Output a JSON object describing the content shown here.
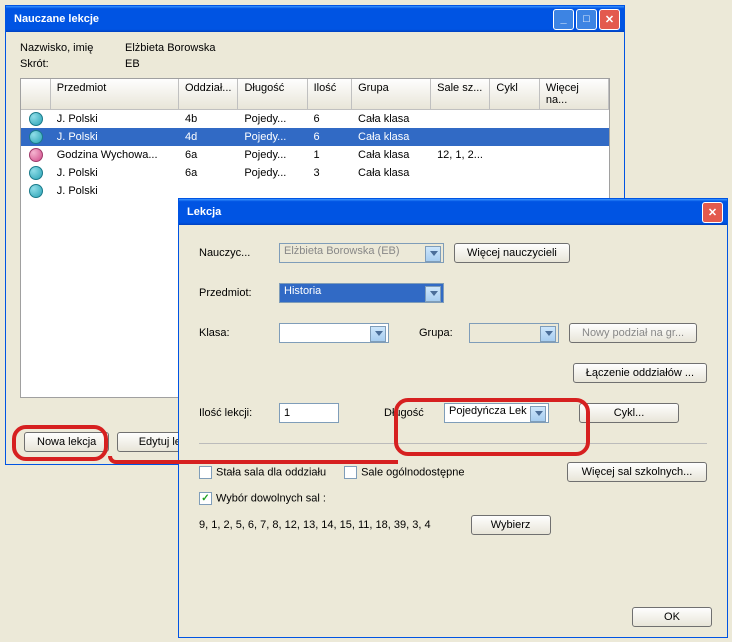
{
  "win1": {
    "title": "Nauczane lekcje",
    "nameLabel": "Nazwisko, imię",
    "nameValue": "Elżbieta Borowska",
    "abbrLabel": "Skrót:",
    "abbrValue": "EB",
    "headers": [
      "Przedmiot",
      "Oddział...",
      "Długość",
      "Ilość",
      "Grupa",
      "Sale sz...",
      "Cykl",
      "Więcej na..."
    ],
    "rows": [
      {
        "icon": "teal",
        "c": [
          "J. Polski",
          "4b",
          "Pojedy...",
          "6",
          "Cała klasa",
          "",
          "",
          ""
        ]
      },
      {
        "icon": "teal",
        "sel": true,
        "c": [
          "J. Polski",
          "4d",
          "Pojedy...",
          "6",
          "Cała klasa",
          "",
          "",
          ""
        ]
      },
      {
        "icon": "pink",
        "c": [
          "Godzina Wychowa...",
          "6a",
          "Pojedy...",
          "1",
          "Cała klasa",
          "12, 1, 2...",
          "",
          ""
        ]
      },
      {
        "icon": "teal",
        "c": [
          "J. Polski",
          "6a",
          "Pojedy...",
          "3",
          "Cała klasa",
          "",
          "",
          ""
        ]
      },
      {
        "icon": "teal",
        "c": [
          "J. Polski",
          "",
          "",
          "",
          "",
          "",
          "",
          ""
        ]
      }
    ],
    "btnNew": "Nowa lekcja",
    "btnEdit": "Edytuj le"
  },
  "win2": {
    "title": "Lekcja",
    "teacherLabel": "Nauczyc...",
    "teacherValue": "Elżbieta Borowska (EB)",
    "moreTeachers": "Więcej nauczycieli",
    "subjectLabel": "Przedmiot:",
    "subjectValue": "Historia",
    "classLabel": "Klasa:",
    "groupLabel": "Grupa:",
    "newDivision": "Nowy podział na gr...",
    "joinDivisions": "Łączenie oddziałów ...",
    "countLabel": "Ilość lekcji:",
    "countValue": "1",
    "lengthLabel": "Długość",
    "lengthValue": "Pojedyńcza Lek",
    "cycleBtn": "Cykl...",
    "cbFixed": "Stała sala dla oddziału",
    "cbPublic": "Sale ogólnodostępne",
    "moreRooms": "Więcej sal szkolnych...",
    "cbAny": "Wybór dowolnych sal :",
    "roomsList": "9, 1, 2, 5, 6, 7, 8, 12, 13, 14, 15, 11, 18, 39, 3, 4",
    "chooseBtn": "Wybierz",
    "okBtn": "OK"
  }
}
